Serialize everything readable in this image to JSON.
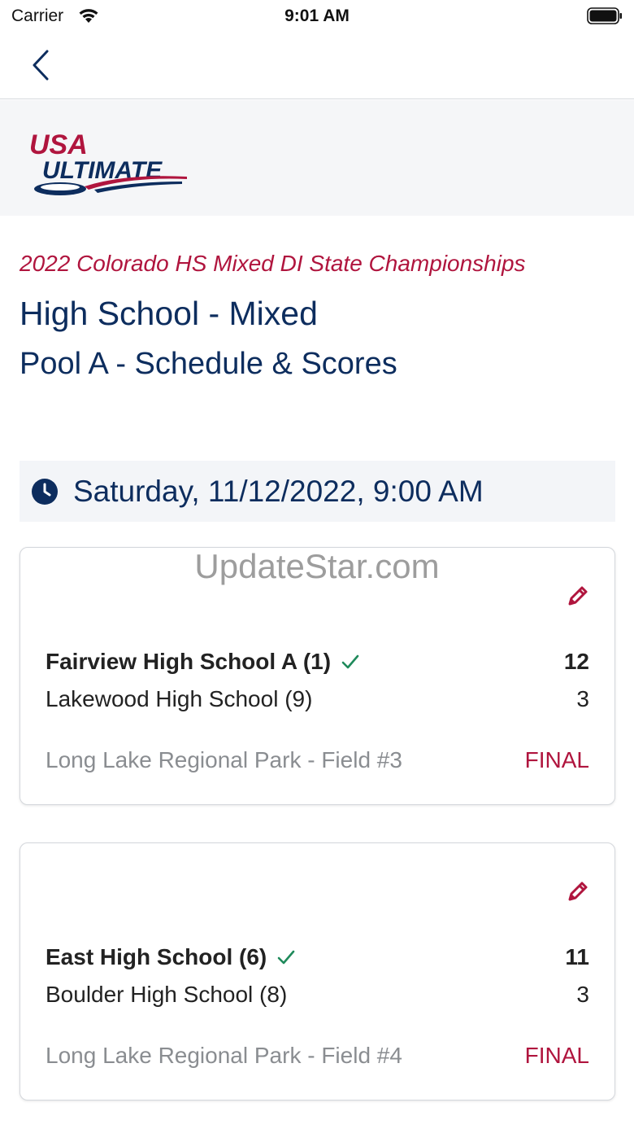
{
  "status_bar": {
    "carrier": "Carrier",
    "time": "9:01 AM"
  },
  "nav": {
    "back_icon": "chevron-left-icon"
  },
  "logo": {
    "line1": "USA",
    "line2": "ULTIMATE",
    "colors": {
      "red": "#b0153e",
      "navy": "#0d2d5e"
    }
  },
  "header": {
    "event": "2022 Colorado HS Mixed DI State Championships",
    "division": "High School - Mixed",
    "pool": "Pool A - Schedule & Scores"
  },
  "schedule": {
    "datetime": "Saturday, 11/12/2022, 9:00 AM",
    "games": [
      {
        "winner": {
          "name": "Fairview High School A (1)",
          "score": "12"
        },
        "loser": {
          "name": "Lakewood High School (9)",
          "score": "3"
        },
        "field": "Long Lake Regional Park - Field #3",
        "status": "FINAL"
      },
      {
        "winner": {
          "name": "East High School (6)",
          "score": "11"
        },
        "loser": {
          "name": "Boulder High School (8)",
          "score": "3"
        },
        "field": "Long Lake Regional Park - Field #4",
        "status": "FINAL"
      }
    ]
  },
  "watermark": "UpdateStar.com",
  "colors": {
    "accent": "#b0153e",
    "navy": "#0d2d5e",
    "check": "#1f8a5b",
    "muted": "#8a8d91"
  }
}
